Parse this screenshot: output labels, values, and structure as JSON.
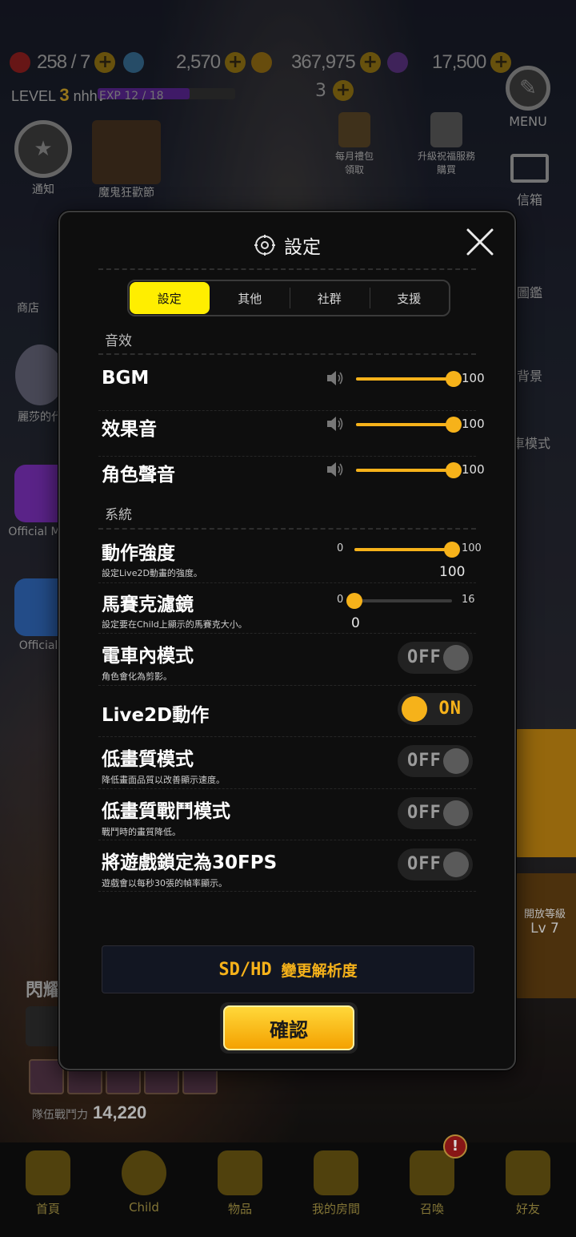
{
  "hud": {
    "hearts": "258 / 7",
    "gems": "2,570",
    "gold": "367,975",
    "potion": "17,500",
    "level_label": "LEVEL",
    "level": "3",
    "player_name": "nhhv",
    "exp": "EXP 12 / 18",
    "exp_progress": 0.667,
    "stamina": "3",
    "menu_label": "MENU"
  },
  "left_side": {
    "event_label": "通知",
    "devilfest_label": "魔鬼狂歡節",
    "shop_label": "商店",
    "character_label": "麗莎的代",
    "official_m": "Official M",
    "official_f": "Official"
  },
  "top_gifts": {
    "monthly": "每月禮包\n領取",
    "upgrade": "升級祝福服務\n購買"
  },
  "right_side": {
    "mailbox": "信箱",
    "gallery": "圖鑑",
    "background": "背景",
    "train_mode": "車模式",
    "unlock_level": "開放等級",
    "lv": "Lv 7"
  },
  "team": {
    "power_label": "隊伍戰鬥力",
    "power": "14,220",
    "shine": "閃耀"
  },
  "bottom_nav": [
    {
      "label": "首頁",
      "icon": "home-icon"
    },
    {
      "label": "Child",
      "icon": "child-icon"
    },
    {
      "label": "物品",
      "icon": "items-icon"
    },
    {
      "label": "我的房間",
      "icon": "room-icon"
    },
    {
      "label": "召喚",
      "icon": "summon-icon"
    },
    {
      "label": "好友",
      "icon": "friends-icon"
    }
  ],
  "summon_badge": "!",
  "dialog": {
    "title": "設定",
    "tabs": [
      "設定",
      "其他",
      "社群",
      "支援"
    ],
    "active_tab": 0,
    "section_sound": "音效",
    "section_system": "系統",
    "bgm": {
      "label": "BGM",
      "value": "100",
      "level": 1.0
    },
    "sfx": {
      "label": "效果音",
      "value": "100",
      "level": 1.0
    },
    "voice": {
      "label": "角色聲音",
      "value": "100",
      "level": 1.0
    },
    "motion": {
      "label": "動作強度",
      "desc": "設定Live2D動畫的強度。",
      "min": "0",
      "max": "100",
      "value": "100",
      "level": 1.0
    },
    "mosaic": {
      "label": "馬賽克濾鏡",
      "desc": "設定要在Child上顯示的馬賽克大小。",
      "min": "0",
      "max": "16",
      "value": "0",
      "level": 0.0
    },
    "train_mode": {
      "label": "電車內模式",
      "desc": "角色會化為剪影。",
      "state": "OFF"
    },
    "live2d": {
      "label": "Live2D動作",
      "desc": "",
      "state": "ON"
    },
    "low_quality": {
      "label": "低畫質模式",
      "desc": "降低畫面品質以改善顯示速度。",
      "state": "OFF"
    },
    "low_battle": {
      "label": "低畫質戰鬥模式",
      "desc": "戰鬥時的畫質降低。",
      "state": "OFF"
    },
    "fps_lock": {
      "label": "將遊戲鎖定為30FPS",
      "desc": "遊戲會以每秒30張的幀率顯示。",
      "state": "OFF"
    },
    "resolution": {
      "tag": "SD/HD",
      "label": "變更解析度"
    },
    "confirm": "確認"
  },
  "colors": {
    "accent": "#f6b21a",
    "tab_active": "#ffee00",
    "dialog_bg": "#0e0e0e"
  }
}
